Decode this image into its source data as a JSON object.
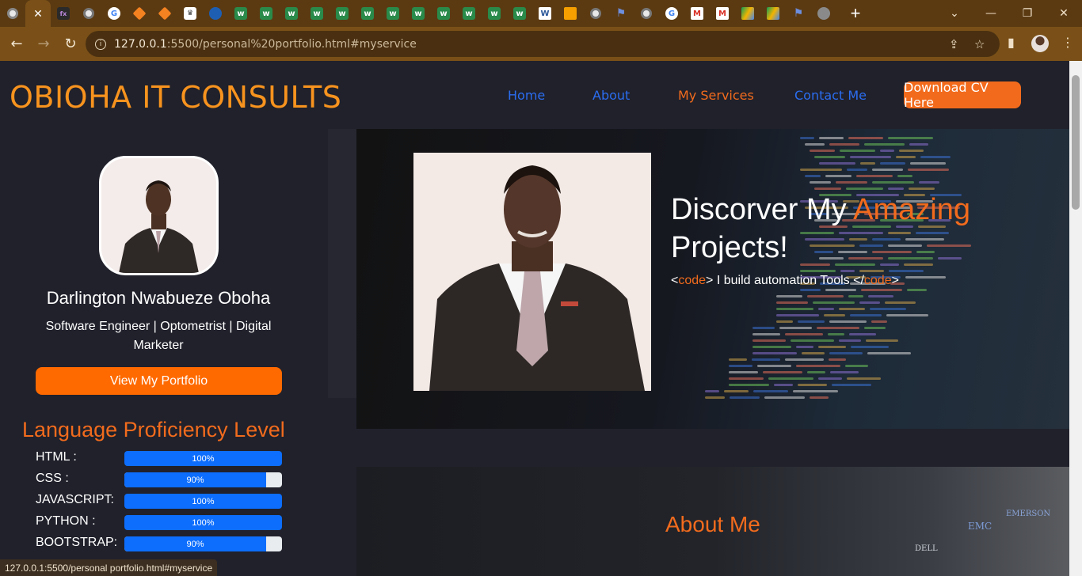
{
  "browser": {
    "active_tab_close": "✕",
    "new_tab": "+",
    "url_host": "127.0.0.1",
    "url_rest": ":5500/personal%20portfolio.html#myservice",
    "status_url": "127.0.0.1:5500/personal portfolio.html#myservice",
    "window": {
      "minimize": "⌄",
      "restore": "—",
      "maximize": "❐",
      "close": "✕"
    }
  },
  "site": {
    "brand": "OBIOHA IT CONSULTS",
    "nav": [
      {
        "label": "Home"
      },
      {
        "label": "About"
      },
      {
        "label": "My Services"
      },
      {
        "label": "Contact Me"
      }
    ],
    "cv_button": "Download CV Here"
  },
  "profile": {
    "name": "Darlington Nwabueze Oboha",
    "tagline": "Software Engineer | Optometrist | Digital Marketer",
    "portfolio_button": "View My Portfolio"
  },
  "languages": {
    "title": "Language Proficiency Level",
    "items": [
      {
        "label": "HTML :",
        "value": 100,
        "text": "100%"
      },
      {
        "label": "CSS :",
        "value": 90,
        "text": "90%"
      },
      {
        "label": "JAVASCRIPT:",
        "value": 100,
        "text": "100%"
      },
      {
        "label": "PYTHON :",
        "value": 100,
        "text": "100%"
      },
      {
        "label": "BOOTSTRAP:",
        "value": 90,
        "text": "90%"
      }
    ]
  },
  "hero": {
    "title_part1": "Discorver My ",
    "title_accent": "Amazing",
    "title_part2": "Projects!",
    "code_open_lt": "<",
    "code_tag": "code",
    "code_open_gt": ">",
    "code_text": " I build automation Tools ",
    "code_close_lt": "</",
    "code_close_tag": "code",
    "code_close_gt": ">"
  },
  "about": {
    "title": "About Me",
    "logos": [
      "EMC",
      "DELL",
      "EMERSON"
    ]
  },
  "colors": {
    "accent": "#f26b1d",
    "nav_link": "#2b6df0",
    "progress": "#0d6efd",
    "page_bg": "#20212b"
  }
}
